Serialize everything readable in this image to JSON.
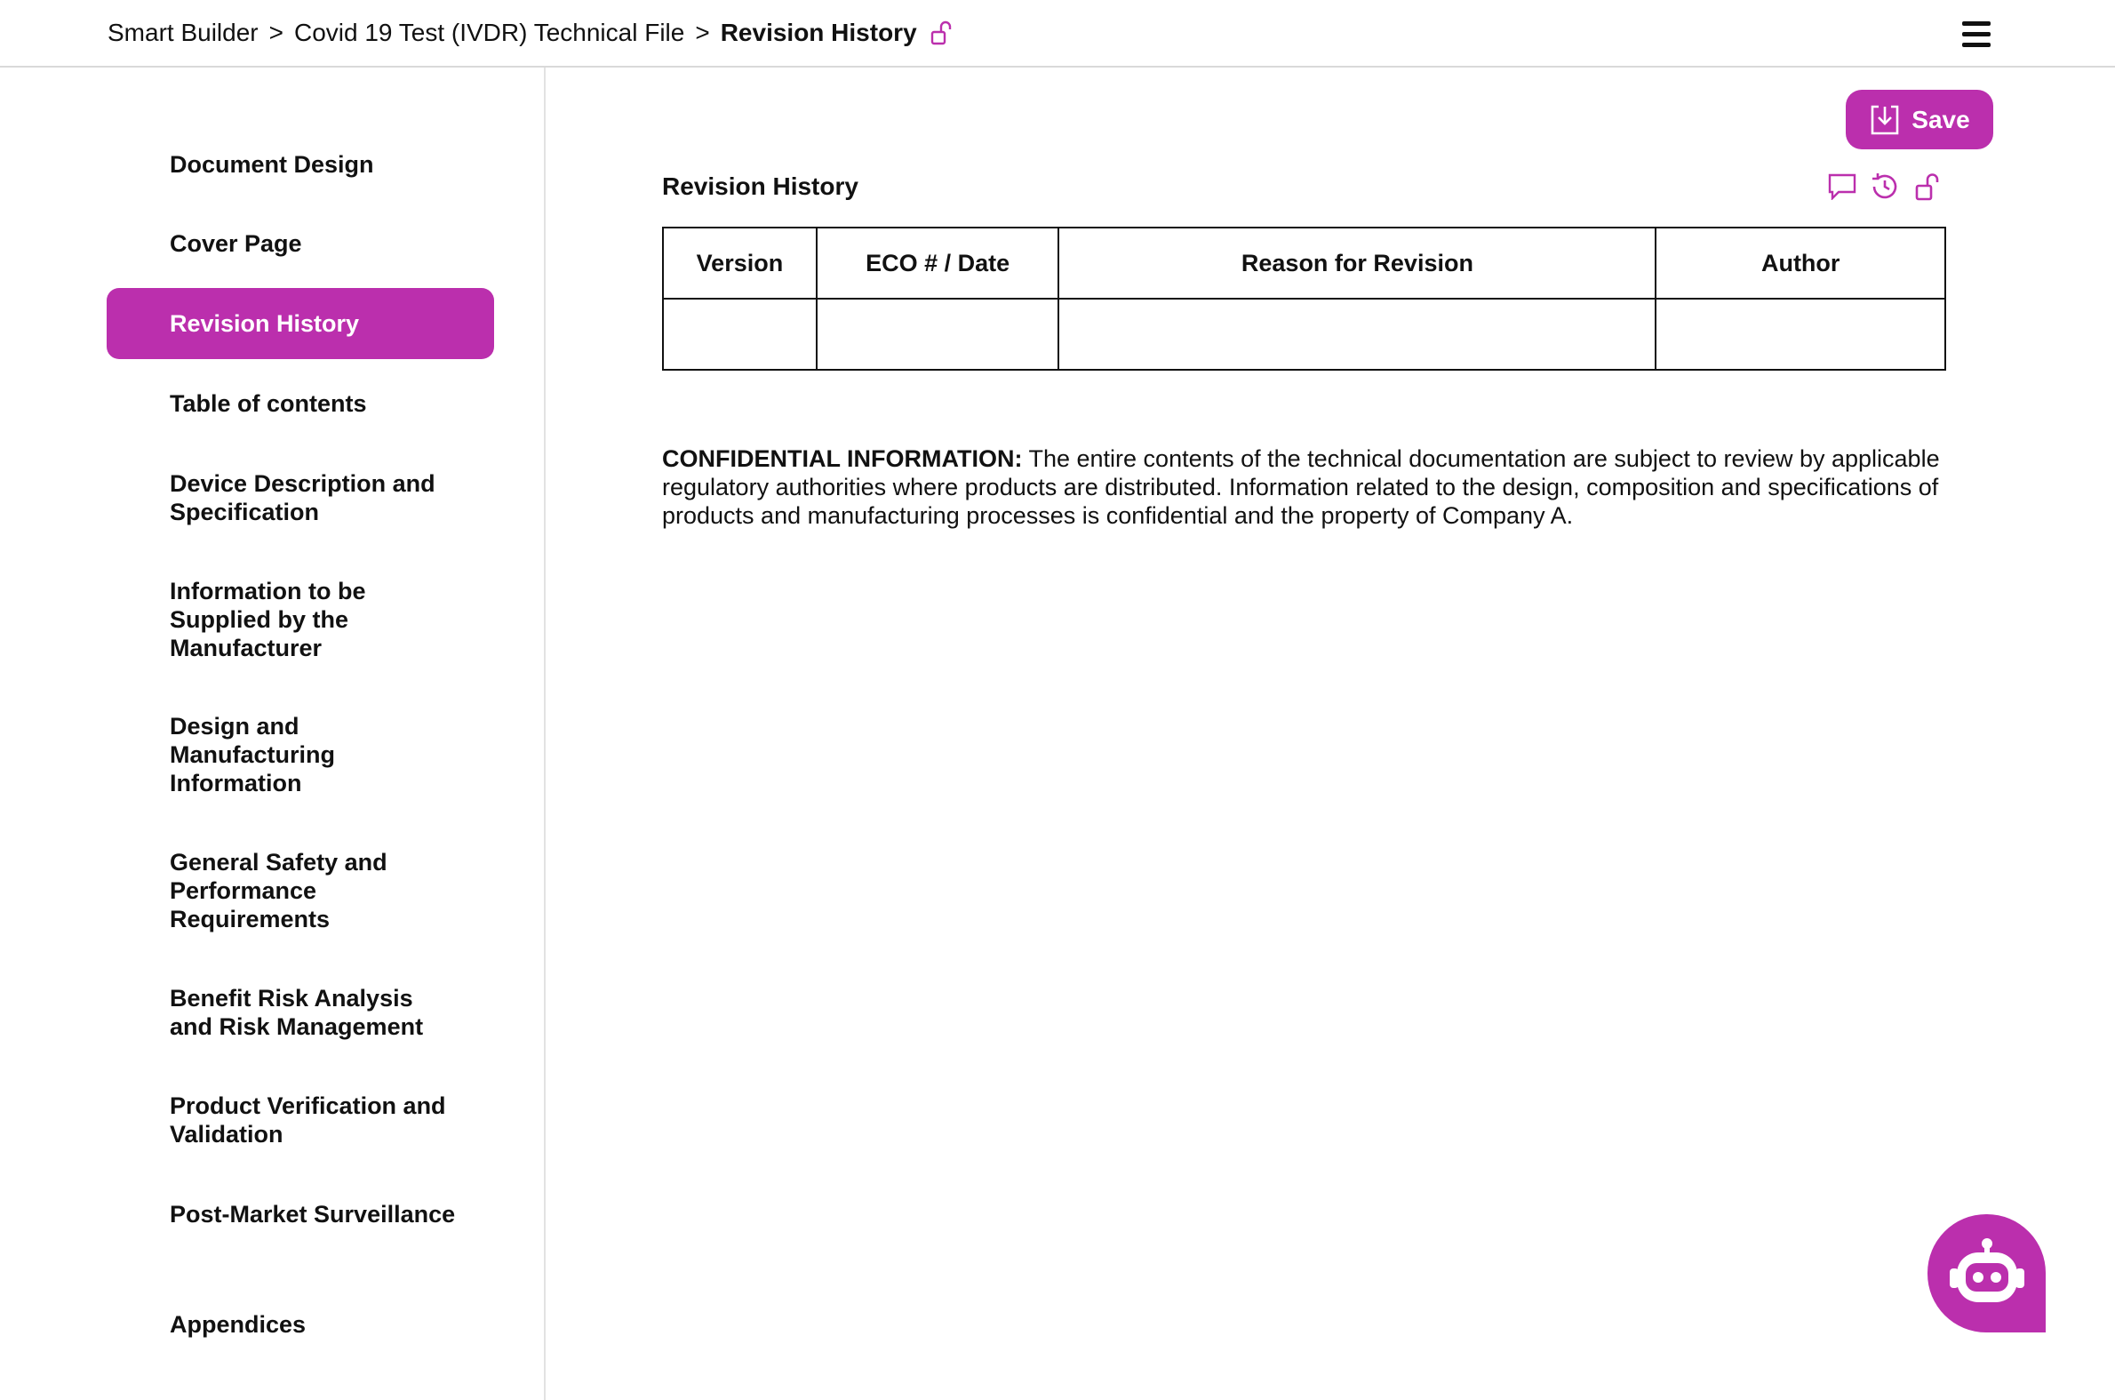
{
  "breadcrumb": {
    "root": "Smart Builder",
    "parent": "Covid 19 Test (IVDR) Technical File",
    "current": "Revision History",
    "separator": ">",
    "lock_icon": "unlock-icon"
  },
  "header": {
    "menu_icon": "hamburger-menu-icon"
  },
  "sidebar": {
    "items": [
      {
        "label": "Document Design",
        "active": false
      },
      {
        "label": "Cover Page",
        "active": false
      },
      {
        "label": "Revision History",
        "active": true
      },
      {
        "label": "Table of contents",
        "active": false
      },
      {
        "label": "Device Description and Specification",
        "active": false
      },
      {
        "label": "Information to be Supplied by the Manufacturer",
        "active": false
      },
      {
        "label": "Design and Manufacturing Information",
        "active": false
      },
      {
        "label": "General Safety and Performance Requirements",
        "active": false
      },
      {
        "label": "Benefit Risk Analysis and Risk Management",
        "active": false
      },
      {
        "label": "Product Verification and Validation",
        "active": false
      },
      {
        "label": "Post-Market Surveillance",
        "active": false
      },
      {
        "label": "Appendices",
        "active": false
      }
    ]
  },
  "toolbar": {
    "save_label": "Save"
  },
  "main": {
    "section_title": "Revision History",
    "icons": [
      "comment-icon",
      "history-icon",
      "unlock-icon"
    ],
    "table": {
      "headers": [
        "Version",
        "ECO # / Date",
        "Reason for Revision",
        "Author"
      ],
      "rows": [
        [
          "",
          "",
          "",
          ""
        ]
      ]
    },
    "confidential": {
      "heading": "CONFIDENTIAL INFORMATION:",
      "text": "The entire contents of the technical documentation are subject to review by applicable regulatory authorities where products are distributed. Information related to the design, composition and specifications of products and manufacturing processes is confidential and the property of Company A."
    }
  },
  "colors": {
    "accent": "#bb2fad",
    "text": "#111111",
    "divider": "#d9d9d9"
  }
}
